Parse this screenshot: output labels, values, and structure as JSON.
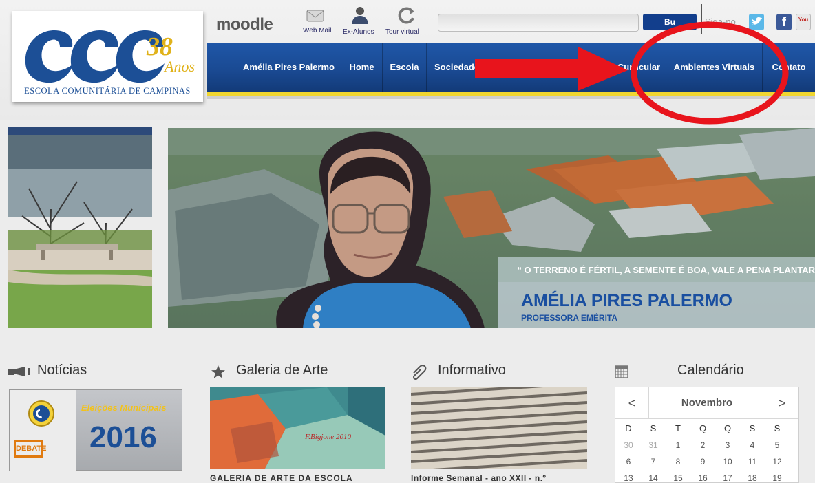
{
  "logo": {
    "tagline": "ESCOLA COMUNITÁRIA DE CAMPINAS",
    "mark": "ECC",
    "anniversary_number": "38",
    "anniversary_word": "Anos"
  },
  "toplinks": {
    "moodle": "moodle",
    "items": [
      {
        "label": "Web Mail",
        "icon": "mail-icon"
      },
      {
        "label": "Ex-Alunos",
        "icon": "person-icon"
      },
      {
        "label": "Tour virtual",
        "icon": "refresh-icon"
      }
    ]
  },
  "search": {
    "value": "",
    "button_label": "Bu"
  },
  "follow": {
    "label": "Siga-no"
  },
  "social": [
    {
      "name": "twitter",
      "glyph": ""
    },
    {
      "name": "facebook",
      "glyph": "f"
    },
    {
      "name": "youtube",
      "glyph": "You"
    }
  ],
  "nav": {
    "items": [
      "Amélia Pires Palermo",
      "Home",
      "Escola",
      "Sociedade",
      "",
      "",
      "Curricular",
      "Ambientes Virtuais",
      "Contato"
    ]
  },
  "banner": {
    "quote": "“ O TERRENO É FÉRTIL, A SEMENTE É BOA, VALE A PENA PLANTAR",
    "name": "AMÉLIA PIRES PALERMO",
    "role": "PROFESSORA EMÉRITA"
  },
  "sections": {
    "news": {
      "title": "Notícias",
      "card_title": "Eleições Municipais",
      "card_year": "2016",
      "card_stamp": "DEBATE"
    },
    "gallery": {
      "title": "Galeria de Arte",
      "caption": "GALERIA DE ARTE DA ESCOLA",
      "signature": "F.Bigjone 2010"
    },
    "info": {
      "title": "Informativo",
      "caption": "Informe Semanal - ano XXII - n.º"
    },
    "calendar": {
      "title": "Calendário"
    }
  },
  "calendar": {
    "month": "Novembro",
    "prev": "<",
    "next": ">",
    "weekdays": [
      "D",
      "S",
      "T",
      "Q",
      "Q",
      "S",
      "S"
    ],
    "rows": [
      [
        "30",
        "31",
        "1",
        "2",
        "3",
        "4",
        "5"
      ],
      [
        "6",
        "7",
        "8",
        "9",
        "10",
        "11",
        "12"
      ],
      [
        "13",
        "14",
        "15",
        "16",
        "17",
        "18",
        "19"
      ]
    ]
  },
  "colors": {
    "nav_blue": "#1a4a93",
    "accent_yellow": "#f0d630",
    "brand_blue": "#1c4f96",
    "annotation_red": "#e8141c"
  }
}
